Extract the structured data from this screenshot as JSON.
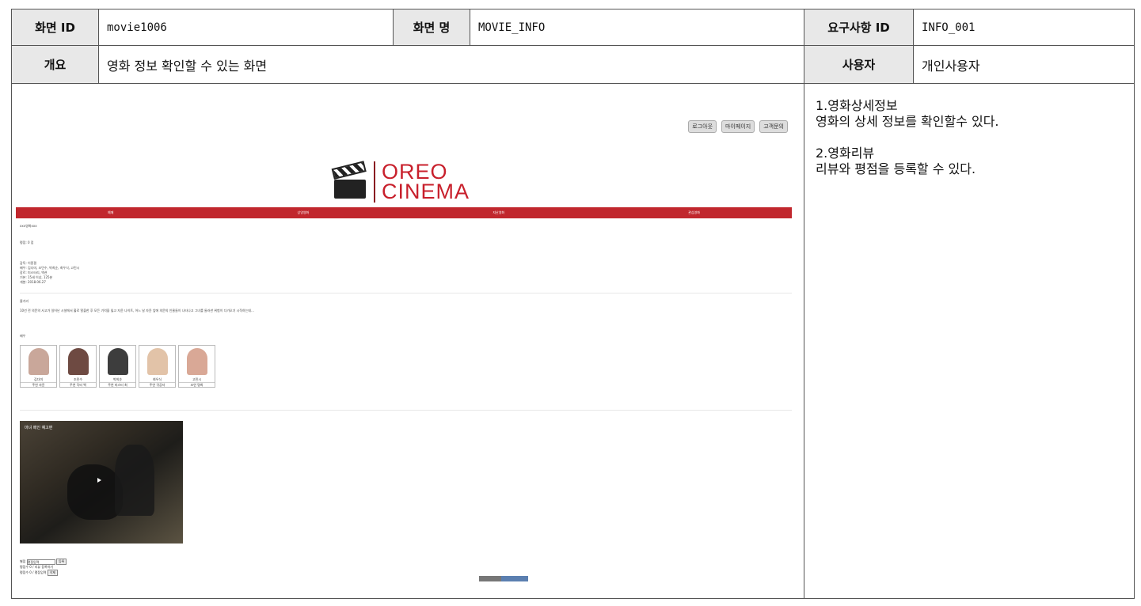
{
  "spec": {
    "screen_id_label": "화면 ID",
    "screen_id_value": "movie1006",
    "screen_name_label": "화면 명",
    "screen_name_value": "MOVIE_INFO",
    "req_id_label": "요구사항 ID",
    "req_id_value": "INFO_001",
    "overview_label": "개요",
    "overview_value": "영화 정보 확인할 수 있는 화면",
    "user_label": "사용자",
    "user_value": "개인사용자"
  },
  "descriptions": [
    {
      "title": "1.영화상세정보",
      "text": "영화의 상세 정보를 확인할수 있다."
    },
    {
      "title": "2.영화리뷰",
      "text": "리뷰와 평점을 등록할 수 있다."
    }
  ],
  "mockup": {
    "top_buttons": [
      "로그아웃",
      "마이페이지",
      "고객문의"
    ],
    "logo_line1": "OREO",
    "logo_line2": "CINEMA",
    "nav": [
      "예매",
      "상영영화",
      "지난영화",
      "관심영화"
    ],
    "movie_title": "xxx영화xxx",
    "rating": "평점: 0 점",
    "info_lines": [
      "감독: 이종필",
      "배우: 김다미, 조민수, 박희순, 최우식, 고민시",
      "장르: 미스터리, 액션",
      "기본: 15세 이상, 125분",
      "개봉: 2018.06.27"
    ],
    "synopsis_label": "줄거리",
    "synopsis_text": "10년 전 의문의 사고가 일어난 시설에서 홀로 탈출한 후 모든 기억을 잃고 자윤 나이트, 어느 날 자윤 앞에 의문의 인물들이 나타나고 그녀를 둘러싼 위험이 다가오기 시작하는데...",
    "cast_label": "배우",
    "cast": [
      {
        "name": "김다미",
        "role": "주연 자윤",
        "color": "#c9a79a"
      },
      {
        "name": "조민수",
        "role": "주연 닥터 백",
        "color": "#6e4a42"
      },
      {
        "name": "박희순",
        "role": "주연 미스터 최",
        "color": "#3d3d3d"
      },
      {
        "name": "최우식",
        "role": "주연 귀공자",
        "color": "#e2c3a8"
      },
      {
        "name": "고민시",
        "role": "조연 명희",
        "color": "#d9a896"
      }
    ],
    "video_title": "마녀 메인 예고편",
    "review_rating_label": "별점",
    "review_placeholder": "평점입력",
    "review_button": "등록",
    "review_line2": "평점수 0 / 리뷰 등록하기",
    "review_line3": "평점수 0 / 평점입력",
    "review_button2": "삭제"
  }
}
